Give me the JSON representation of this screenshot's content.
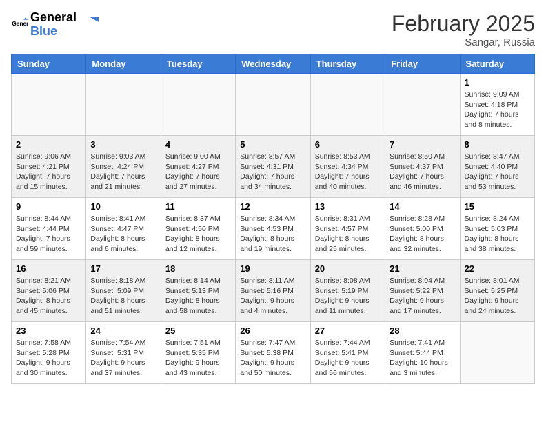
{
  "header": {
    "logo_general": "General",
    "logo_blue": "Blue",
    "month_title": "February 2025",
    "location": "Sangar, Russia"
  },
  "weekdays": [
    "Sunday",
    "Monday",
    "Tuesday",
    "Wednesday",
    "Thursday",
    "Friday",
    "Saturday"
  ],
  "weeks": [
    [
      {
        "day": "",
        "info": ""
      },
      {
        "day": "",
        "info": ""
      },
      {
        "day": "",
        "info": ""
      },
      {
        "day": "",
        "info": ""
      },
      {
        "day": "",
        "info": ""
      },
      {
        "day": "",
        "info": ""
      },
      {
        "day": "1",
        "info": "Sunrise: 9:09 AM\nSunset: 4:18 PM\nDaylight: 7 hours\nand 8 minutes."
      }
    ],
    [
      {
        "day": "2",
        "info": "Sunrise: 9:06 AM\nSunset: 4:21 PM\nDaylight: 7 hours\nand 15 minutes."
      },
      {
        "day": "3",
        "info": "Sunrise: 9:03 AM\nSunset: 4:24 PM\nDaylight: 7 hours\nand 21 minutes."
      },
      {
        "day": "4",
        "info": "Sunrise: 9:00 AM\nSunset: 4:27 PM\nDaylight: 7 hours\nand 27 minutes."
      },
      {
        "day": "5",
        "info": "Sunrise: 8:57 AM\nSunset: 4:31 PM\nDaylight: 7 hours\nand 34 minutes."
      },
      {
        "day": "6",
        "info": "Sunrise: 8:53 AM\nSunset: 4:34 PM\nDaylight: 7 hours\nand 40 minutes."
      },
      {
        "day": "7",
        "info": "Sunrise: 8:50 AM\nSunset: 4:37 PM\nDaylight: 7 hours\nand 46 minutes."
      },
      {
        "day": "8",
        "info": "Sunrise: 8:47 AM\nSunset: 4:40 PM\nDaylight: 7 hours\nand 53 minutes."
      }
    ],
    [
      {
        "day": "9",
        "info": "Sunrise: 8:44 AM\nSunset: 4:44 PM\nDaylight: 7 hours\nand 59 minutes."
      },
      {
        "day": "10",
        "info": "Sunrise: 8:41 AM\nSunset: 4:47 PM\nDaylight: 8 hours\nand 6 minutes."
      },
      {
        "day": "11",
        "info": "Sunrise: 8:37 AM\nSunset: 4:50 PM\nDaylight: 8 hours\nand 12 minutes."
      },
      {
        "day": "12",
        "info": "Sunrise: 8:34 AM\nSunset: 4:53 PM\nDaylight: 8 hours\nand 19 minutes."
      },
      {
        "day": "13",
        "info": "Sunrise: 8:31 AM\nSunset: 4:57 PM\nDaylight: 8 hours\nand 25 minutes."
      },
      {
        "day": "14",
        "info": "Sunrise: 8:28 AM\nSunset: 5:00 PM\nDaylight: 8 hours\nand 32 minutes."
      },
      {
        "day": "15",
        "info": "Sunrise: 8:24 AM\nSunset: 5:03 PM\nDaylight: 8 hours\nand 38 minutes."
      }
    ],
    [
      {
        "day": "16",
        "info": "Sunrise: 8:21 AM\nSunset: 5:06 PM\nDaylight: 8 hours\nand 45 minutes."
      },
      {
        "day": "17",
        "info": "Sunrise: 8:18 AM\nSunset: 5:09 PM\nDaylight: 8 hours\nand 51 minutes."
      },
      {
        "day": "18",
        "info": "Sunrise: 8:14 AM\nSunset: 5:13 PM\nDaylight: 8 hours\nand 58 minutes."
      },
      {
        "day": "19",
        "info": "Sunrise: 8:11 AM\nSunset: 5:16 PM\nDaylight: 9 hours\nand 4 minutes."
      },
      {
        "day": "20",
        "info": "Sunrise: 8:08 AM\nSunset: 5:19 PM\nDaylight: 9 hours\nand 11 minutes."
      },
      {
        "day": "21",
        "info": "Sunrise: 8:04 AM\nSunset: 5:22 PM\nDaylight: 9 hours\nand 17 minutes."
      },
      {
        "day": "22",
        "info": "Sunrise: 8:01 AM\nSunset: 5:25 PM\nDaylight: 9 hours\nand 24 minutes."
      }
    ],
    [
      {
        "day": "23",
        "info": "Sunrise: 7:58 AM\nSunset: 5:28 PM\nDaylight: 9 hours\nand 30 minutes."
      },
      {
        "day": "24",
        "info": "Sunrise: 7:54 AM\nSunset: 5:31 PM\nDaylight: 9 hours\nand 37 minutes."
      },
      {
        "day": "25",
        "info": "Sunrise: 7:51 AM\nSunset: 5:35 PM\nDaylight: 9 hours\nand 43 minutes."
      },
      {
        "day": "26",
        "info": "Sunrise: 7:47 AM\nSunset: 5:38 PM\nDaylight: 9 hours\nand 50 minutes."
      },
      {
        "day": "27",
        "info": "Sunrise: 7:44 AM\nSunset: 5:41 PM\nDaylight: 9 hours\nand 56 minutes."
      },
      {
        "day": "28",
        "info": "Sunrise: 7:41 AM\nSunset: 5:44 PM\nDaylight: 10 hours\nand 3 minutes."
      },
      {
        "day": "",
        "info": ""
      }
    ]
  ]
}
